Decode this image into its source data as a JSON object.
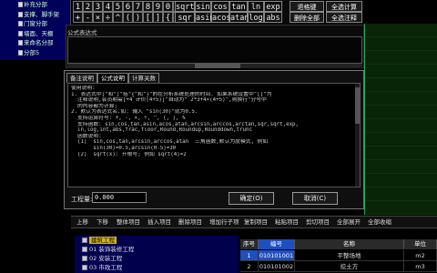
{
  "top_tree": {
    "items": [
      "补充分部",
      "支撑、脚手架",
      "门窗分部",
      "墙面、天棚",
      "来命名分部",
      "分部5"
    ]
  },
  "keypad": {
    "row1": [
      "1",
      "2",
      "3",
      "4",
      "5",
      "6",
      "7",
      "8",
      "9",
      "0",
      "."
    ],
    "row2": [
      "+",
      "-",
      "×",
      "÷",
      "^",
      "(",
      ")",
      "[",
      "]",
      "{",
      "}"
    ],
    "func_row1": [
      "sqrt",
      "sin",
      "cos",
      "tan",
      "ln",
      "exp"
    ],
    "func_row2": [
      "sqr",
      "asin",
      "acos",
      "atan",
      "log",
      "abs"
    ],
    "actions_row1": [
      "退格键",
      "全选计算"
    ],
    "actions_row2": [
      "删除全部",
      "全选注释"
    ]
  },
  "formula": {
    "title": "公式表达式"
  },
  "dialog": {
    "tabs": [
      "备注说明",
      "公式说明",
      "计算关数"
    ],
    "help_lines": [
      "使用说明:",
      "1. 表达式中[\"和\"]\"括\"{\"和\"}\"的在分析系统处理的时间. 如果系统设置中\"[]\"为",
      "  注释说明,会员期需[+4 计价(4+5)]\"自动为\" 2*3+4×(4+5)\",则换行\"分号中",
      "  的内容都为计算;",
      "",
      "2. 默认为表达式名.如: 输入 \"sin(30)\"就为0.5.",
      "  支持运算符号: +, -, ×, ÷, ^, (, ), %",
      "  支持函数: sin,cos,tan,asin,acos,atan,arcsin,arccos,arctan,sqr,sqrt,exp,",
      "  ln,log,int,abs,frac,floor,Round,Roundup,Rounddown,trunc",
      "  函数说明:",
      "  (1)  sin,cos,tan,arcsin,arccos,atan  三角函数,默认为度模式, 例如",
      "       sin(30)=0.5,arcsin(0.5)=30",
      "  (2)  sqrt(x): 开根号; 例如 sqrt(4)=2"
    ],
    "qty_label": "工程量:",
    "qty_value": "0.000",
    "ok_label": "确定(O)",
    "cancel_label": "取消(C)"
  },
  "toolbar": {
    "items": [
      "上移",
      "下移",
      "整体项目",
      "插入项目",
      "删除项目",
      "增加行子项",
      "复制项目",
      "粘贴项目",
      "剪切项目",
      "全部展开",
      "全部收缩"
    ]
  },
  "bottom_tree": {
    "items": [
      {
        "num": "",
        "label": "建筑工程",
        "selected": true
      },
      {
        "num": "01",
        "label": "装饰装修工程",
        "selected": false
      },
      {
        "num": "02",
        "label": "安装工程",
        "selected": false
      },
      {
        "num": "03",
        "label": "市政工程",
        "selected": false
      }
    ]
  },
  "table": {
    "headers": [
      "序号",
      "编号",
      "名称",
      "单位"
    ],
    "rows": [
      {
        "seq": "1",
        "code": "010101001",
        "name": "平整场地",
        "unit": "m2"
      },
      {
        "seq": "2",
        "code": "010101002",
        "name": "挖土方",
        "unit": "m3"
      }
    ]
  },
  "colors": {
    "tree_bg": "#00005a",
    "panel_green": "#082508",
    "selection_blue": "#1f4fbf",
    "selection_yellow": "#d8b400"
  }
}
